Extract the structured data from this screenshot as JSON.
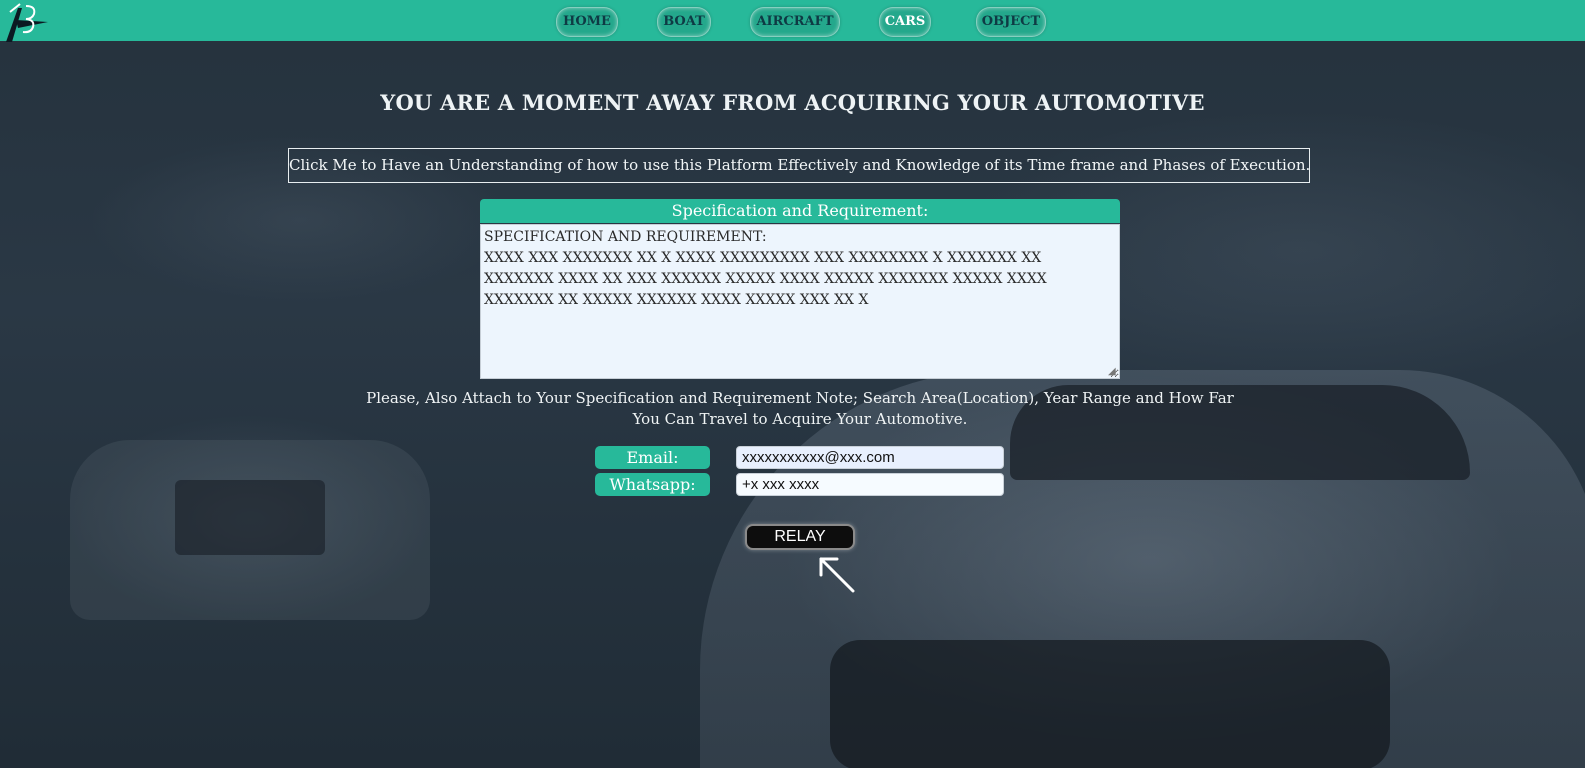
{
  "nav": {
    "items": [
      {
        "label": "HOME",
        "active": false
      },
      {
        "label": "BOAT",
        "active": false
      },
      {
        "label": "AIRCRAFT",
        "active": false
      },
      {
        "label": "CARS",
        "active": true
      },
      {
        "label": "OBJECT",
        "active": false
      }
    ]
  },
  "main": {
    "headline": "YOU ARE A MOMENT AWAY FROM ACQUIRING YOUR AUTOMOTIVE",
    "guide_link": "Click Me to Have an Understanding of how to use this Platform Effectively and Knowledge of its Time frame and Phases of Execution.",
    "spec": {
      "header": "Specification and Requirement:",
      "value": "SPECIFICATION AND REQUIREMENT:\nXXXX XXX XXXXXXX XX X XXXX XXXXXXXXX XXX XXXXXXXX X XXXXXXX XX\nXXXXXXX XXXX XX XXX XXXXXX XXXXX XXXX XXXXX XXXXXXX XXXXX XXXX\nXXXXXXX XX XXXXX XXXXXX XXXX XXXXX XXX XX X"
    },
    "attach_note": "Please, Also Attach to Your Specification and Requirement Note;   Search Area(Location), Year Range and How Far You Can Travel to Acquire Your Automotive.",
    "email": {
      "label": "Email:",
      "value": "xxxxxxxxxxx@xxx.com"
    },
    "whatsapp": {
      "label": "Whatsapp:",
      "value": "+x xxx xxxx"
    },
    "submit_label": "RELAY"
  },
  "colors": {
    "accent": "#27b99a",
    "input_bg": "#edf5fd",
    "button_bg": "#0d0d0d"
  }
}
